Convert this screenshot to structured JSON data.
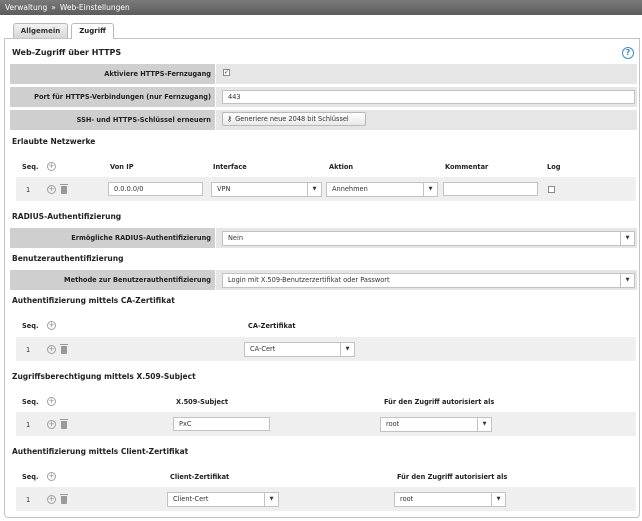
{
  "breadcrumb": {
    "parent": "Verwaltung",
    "separator": "»",
    "current": "Web-Einstellungen"
  },
  "tabs": [
    {
      "label": "Allgemein",
      "active": false
    },
    {
      "label": "Zugriff",
      "active": true
    }
  ],
  "https_section": {
    "title": "Web-Zugriff über HTTPS",
    "help_icon": "question-circle-icon",
    "enable_label": "Aktiviere HTTPS-Fernzugang",
    "enable_checked": true,
    "enable_checkmark": "✓",
    "port_label": "Port für HTTPS-Verbindungen (nur Fernzugang)",
    "port_value": "443",
    "keys_label": "SSH- und HTTPS-Schlüssel erneuern",
    "keys_icon": "key-icon",
    "keys_button": "Generiere neue 2048 bit Schlüssel"
  },
  "networks": {
    "title": "Erlaubte Netzwerke",
    "columns": {
      "seq": "Seq.",
      "from_ip": "Von IP",
      "interface": "Interface",
      "action": "Aktion",
      "comment": "Kommentar",
      "log": "Log"
    },
    "rows": [
      {
        "seq": "1",
        "from_ip": "0.0.0.0/0",
        "interface": "VPN",
        "action": "Annehmen",
        "comment": "",
        "log": false
      }
    ]
  },
  "radius": {
    "title": "RADIUS-Authentifizierung",
    "label": "Ermögliche RADIUS-Authentifizierung",
    "value": "Nein"
  },
  "user_auth": {
    "title": "Benutzerauthentifizierung",
    "label": "Methode zur Benutzerauthentifizierung",
    "value": "Login mit X.509-Benutzerzertifikat oder Passwort"
  },
  "ca_auth": {
    "title": "Authentifizierung mittels CA-Zertifikat",
    "columns": {
      "seq": "Seq.",
      "cert": "CA-Zertifikat"
    },
    "rows": [
      {
        "seq": "1",
        "cert": "CA-Cert"
      }
    ]
  },
  "subject_auth": {
    "title": "Zugriffsberechtigung mittels X.509-Subject",
    "columns": {
      "seq": "Seq.",
      "subject": "X.509-Subject",
      "authorized_as": "Für den Zugriff autorisiert als"
    },
    "rows": [
      {
        "seq": "1",
        "subject": "PxC",
        "authorized_as": "root"
      }
    ]
  },
  "client_auth": {
    "title": "Authentifizierung mittels Client-Zertifikat",
    "columns": {
      "seq": "Seq.",
      "cert": "Client-Zertifikat",
      "authorized_as": "Für den Zugriff autorisiert als"
    },
    "rows": [
      {
        "seq": "1",
        "cert": "Client-Cert",
        "authorized_as": "root"
      }
    ]
  },
  "icons": {
    "plus": "+",
    "dropdown": "▼"
  }
}
